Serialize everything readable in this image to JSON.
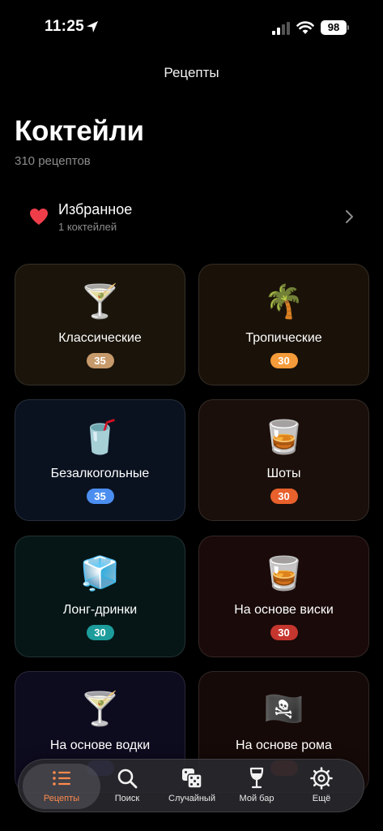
{
  "status_bar": {
    "time": "11:25",
    "battery": "98"
  },
  "nav": {
    "title": "Рецепты"
  },
  "header": {
    "title": "Коктейли",
    "subtitle": "310 рецептов"
  },
  "favorites": {
    "title": "Избранное",
    "subtitle": "1 коктейлей",
    "icon": "heart-icon"
  },
  "categories": [
    {
      "emoji": "🍸",
      "label": "Классические",
      "count": "35",
      "badge_color": "#c79a6b",
      "bg": "#1a140a"
    },
    {
      "emoji": "🌴",
      "label": "Тропические",
      "count": "30",
      "badge_color": "#f59b3a",
      "bg": "#1a1208"
    },
    {
      "emoji": "🥤",
      "label": "Безалкогольные",
      "count": "35",
      "badge_color": "#4b8ef0",
      "bg": "#0a1220"
    },
    {
      "emoji": "🥃",
      "label": "Шоты",
      "count": "30",
      "badge_color": "#e8602c",
      "bg": "#1a0f0a"
    },
    {
      "emoji": "🧊",
      "label": "Лонг-дринки",
      "count": "30",
      "badge_color": "#1d9c9c",
      "bg": "#061616"
    },
    {
      "emoji": "🥃",
      "label": "На основе виски",
      "count": "30",
      "badge_color": "#c5362e",
      "bg": "#1a0a0a"
    },
    {
      "emoji": "🍸",
      "label": "На основе водки",
      "count": "",
      "badge_color": "#5b4ae0",
      "bg": "#0d0b1e"
    },
    {
      "emoji": "🏴‍☠️",
      "label": "На основе рома",
      "count": "",
      "badge_color": "#c5362e",
      "bg": "#160a08"
    }
  ],
  "tabs": [
    {
      "label": "Рецепты",
      "icon": "list-icon",
      "active": true
    },
    {
      "label": "Поиск",
      "icon": "search-icon",
      "active": false
    },
    {
      "label": "Случайный",
      "icon": "dice-icon",
      "active": false
    },
    {
      "label": "Мой бар",
      "icon": "wine-glass-icon",
      "active": false
    },
    {
      "label": "Ещё",
      "icon": "gear-icon",
      "active": false
    }
  ],
  "colors": {
    "accent": "#ff8a4c",
    "heart": "#ef3e4a",
    "background": "#000000"
  }
}
